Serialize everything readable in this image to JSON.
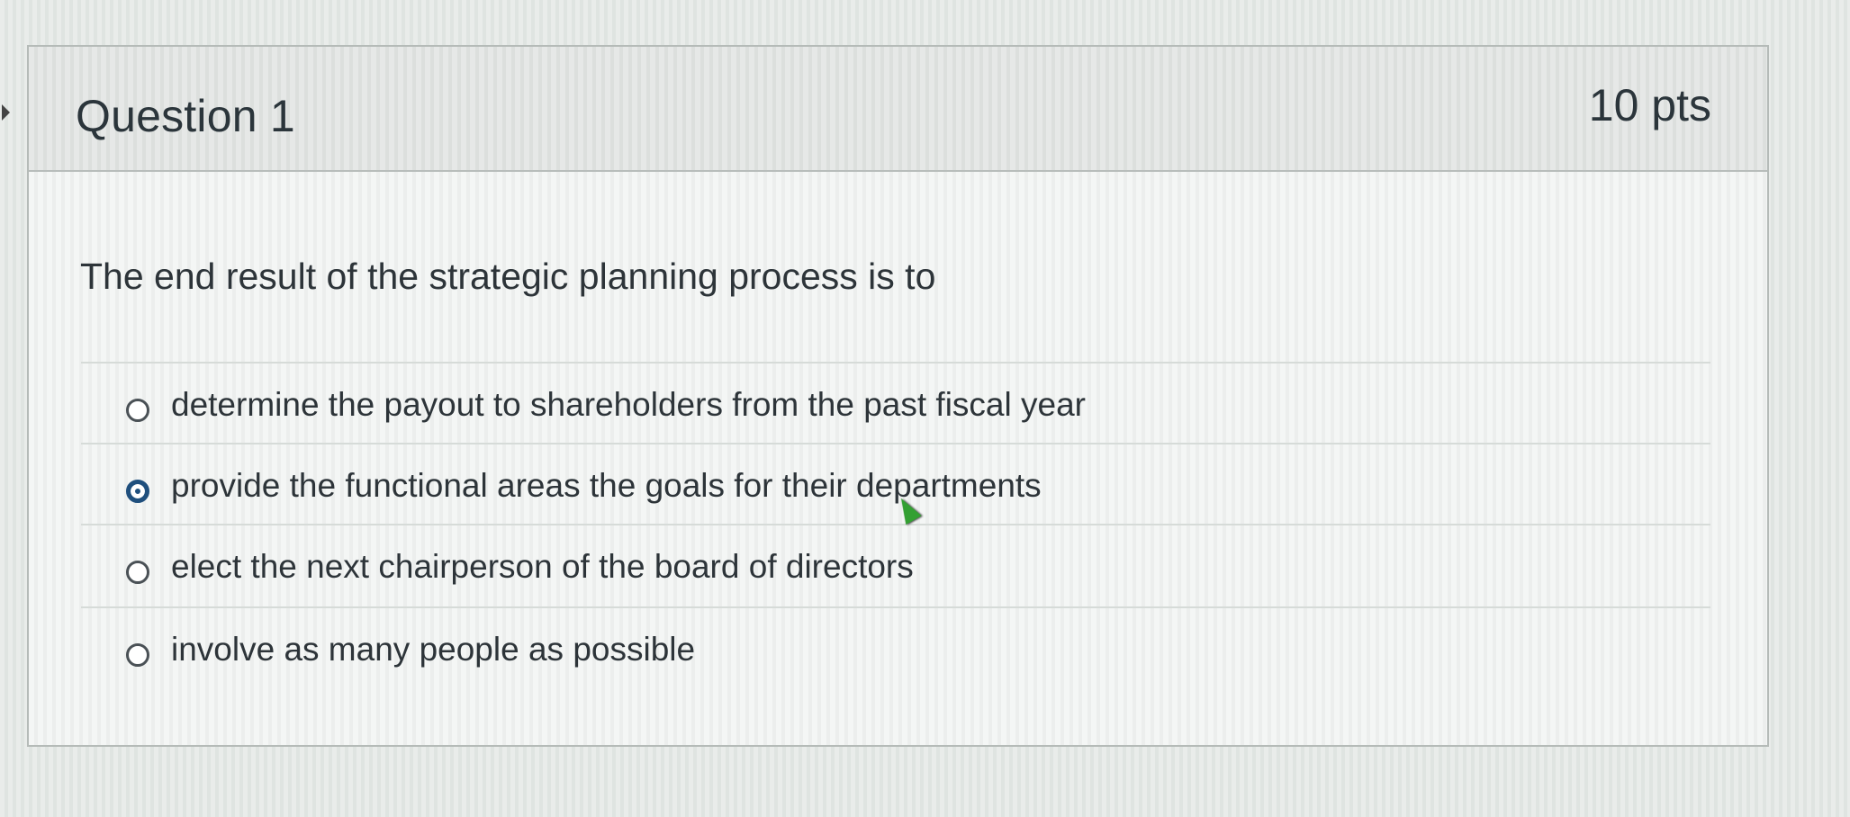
{
  "question": {
    "title": "Question 1",
    "points": "10 pts",
    "text": "The end result of the strategic planning process is to"
  },
  "answers": [
    {
      "label": "determine the payout to shareholders from the past fiscal year",
      "selected": false
    },
    {
      "label": "provide the functional areas the goals for their departments",
      "selected": true
    },
    {
      "label": "elect the next chairperson of the board of directors",
      "selected": false
    },
    {
      "label": "involve as many people as possible",
      "selected": false
    }
  ],
  "colors": {
    "selected_radio": "#1f4f7d",
    "cursor": "#33a032",
    "text": "#2d3439"
  },
  "icons": {
    "cursor": "mouse-pointer-icon",
    "side_chevron": "chevron-right-icon"
  }
}
